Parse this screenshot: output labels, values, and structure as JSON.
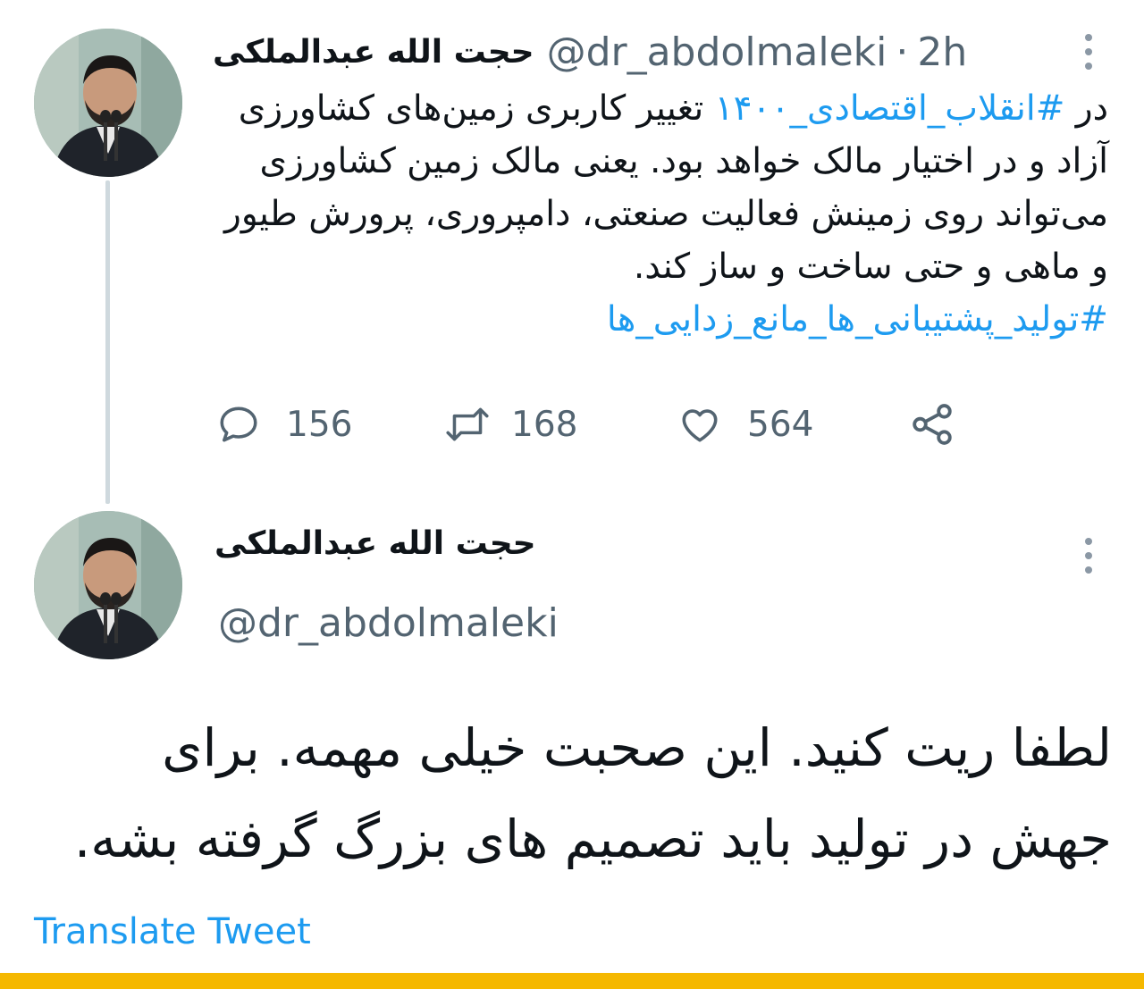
{
  "tweet": {
    "display_name": "حجت الله عبدالملکی",
    "handle": "@dr_abdolmaleki",
    "separator": "·",
    "time": "2h",
    "text": {
      "lead": "در ",
      "hashtag1": "#انقلاب_اقتصادی_۱۴۰۰",
      "body": " تغییر کاربری زمین‌های کشاورزی آزاد و در اختیار مالک خواهد بود. یعنی مالک زمین کشاورزی می‌تواند روی زمینش فعالیت صنعتی، دامپروری، پرورش طیور و ماهی و حتی ساخت و ساز کند.",
      "hashtag2": "#تولید_پشتیبانی_ها_مانع_زدایی_ها"
    },
    "replies": "156",
    "retweets": "168",
    "likes": "564"
  },
  "reply": {
    "display_name": "حجت الله عبدالملکی",
    "handle": "@dr_abdolmaleki",
    "text": "لطفا ریت کنید. این صحبت خیلی مهمه. برای جهش در تولید باید تصمیم های بزرگ گرفته بشه.",
    "translate_label": "Translate Tweet"
  },
  "colors": {
    "link": "#1d9bf0",
    "secondary_text": "#536471",
    "bottom_bar": "#f5b800"
  },
  "icons": [
    "more-vertical-icon",
    "reply-icon",
    "retweet-icon",
    "like-icon",
    "share-icon"
  ]
}
